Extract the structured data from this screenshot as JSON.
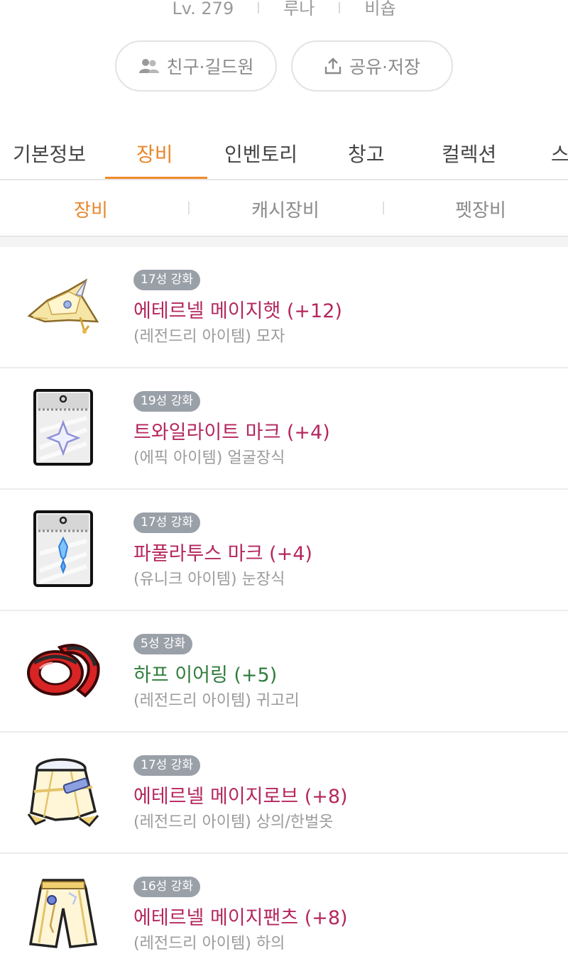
{
  "profile": {
    "level": "Lv. 279",
    "world": "루나",
    "job": "비숍"
  },
  "actions": {
    "friends_label": "친구·길드원",
    "share_label": "공유·저장"
  },
  "tabs": [
    {
      "label": "기본정보"
    },
    {
      "label": "장비"
    },
    {
      "label": "인벤토리"
    },
    {
      "label": "창고"
    },
    {
      "label": "컬렉션"
    },
    {
      "label": "스"
    }
  ],
  "active_tab": "장비",
  "subtabs": [
    {
      "label": "장비"
    },
    {
      "label": "캐시장비"
    },
    {
      "label": "펫장비"
    }
  ],
  "colors": {
    "accent": "#e8862b",
    "legendary": "#b5275e",
    "epic": "#b5275e",
    "unique": "#b5275e",
    "green": "#2f7d3c",
    "badge_bg": "#9aa0a8"
  },
  "items": [
    {
      "badge": "17성 강화",
      "name": "에테르넬 메이지햇 (+12)",
      "sub": "(레전드리 아이템) 모자",
      "icon": "mage-hat-icon"
    },
    {
      "badge": "19성 강화",
      "name": "트와일라이트 마크 (+4)",
      "sub": "(에픽 아이템) 얼굴장식",
      "icon": "twilight-mark-icon"
    },
    {
      "badge": "17성 강화",
      "name": "파풀라투스 마크 (+4)",
      "sub": "(유니크 아이템) 눈장식",
      "icon": "papulatus-mark-icon"
    },
    {
      "badge": "5성 강화",
      "name": "하프 이어링 (+5)",
      "sub": "(레전드리 아이템) 귀고리",
      "icon": "earring-icon"
    },
    {
      "badge": "17성 강화",
      "name": "에테르넬 메이지로브 (+8)",
      "sub": "(레전드리 아이템) 상의/한벌옷",
      "icon": "mage-robe-icon"
    },
    {
      "badge": "16성 강화",
      "name": "에테르넬 메이지팬츠 (+8)",
      "sub": "(레전드리 아이템) 하의",
      "icon": "mage-pants-icon"
    }
  ]
}
